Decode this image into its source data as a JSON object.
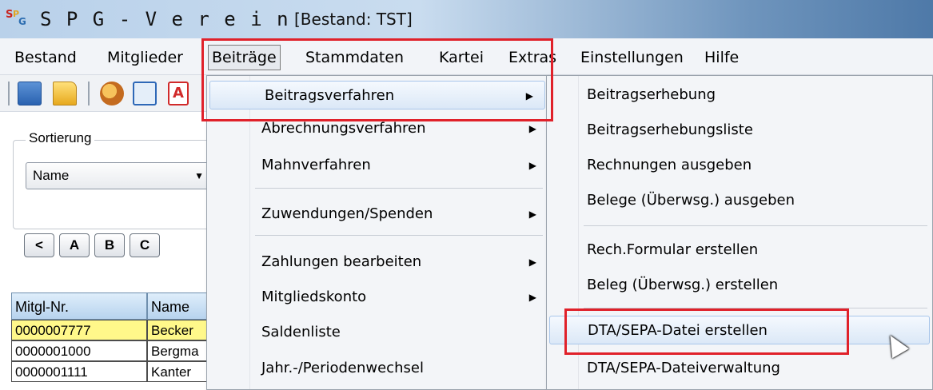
{
  "window": {
    "title": "S P G - V e r e i n",
    "subtitle": "[Bestand: TST]",
    "logo": {
      "s": "S",
      "p": "P",
      "g": "G"
    }
  },
  "menubar": {
    "items": [
      "Bestand",
      "Mitglieder",
      "Beiträge",
      "Stammdaten",
      "Kartei",
      "Extras",
      "Einstellungen",
      "Hilfe"
    ],
    "active": "Beiträge"
  },
  "toolbar": {
    "icons": [
      "copy-icon",
      "open-folder-icon",
      "members-icon",
      "document-icon",
      "letter-icon"
    ],
    "letter_glyph": "A"
  },
  "sort": {
    "label": "Sortierung",
    "value": "Name"
  },
  "alpha_buttons": [
    "<",
    "A",
    "B",
    "C"
  ],
  "table": {
    "headers": [
      "Mitgl-Nr.",
      "Name"
    ],
    "rows": [
      {
        "nr": "0000007777",
        "name": "Becker",
        "selected": true
      },
      {
        "nr": "0000001000",
        "name": "Bergma",
        "selected": false
      },
      {
        "nr": "0000001111",
        "name": "Kanter",
        "selected": false
      }
    ]
  },
  "beitraege_menu": {
    "items": [
      {
        "label": "Beitragsverfahren",
        "submenu": true,
        "highlighted": true
      },
      {
        "label": "Abrechnungsverfahren",
        "submenu": true
      },
      {
        "label": "Mahnverfahren",
        "submenu": true
      },
      {
        "label": "Zuwendungen/Spenden",
        "submenu": true
      },
      {
        "label": "Zahlungen bearbeiten",
        "submenu": true
      },
      {
        "label": "Mitgliedskonto",
        "submenu": true
      },
      {
        "label": "Saldenliste",
        "submenu": false
      },
      {
        "label": "Jahr.-/Periodenwechsel",
        "submenu": false
      }
    ]
  },
  "beitragsverfahren_submenu": {
    "items": [
      {
        "label": "Beitragserhebung"
      },
      {
        "label": "Beitragserhebungsliste"
      },
      {
        "label": "Rechnungen ausgeben"
      },
      {
        "label": "Belege (Überwsg.) ausgeben"
      },
      {
        "label": "Rech.Formular erstellen"
      },
      {
        "label": "Beleg (Überwsg.) erstellen"
      },
      {
        "label": "DTA/SEPA-Datei erstellen",
        "highlighted": true
      },
      {
        "label": "DTA/SEPA-Dateiverwaltung"
      }
    ]
  },
  "submenu_arrow": "▶",
  "colors": {
    "highlight_box": "#e0212a",
    "selected_row": "#fff88a"
  }
}
